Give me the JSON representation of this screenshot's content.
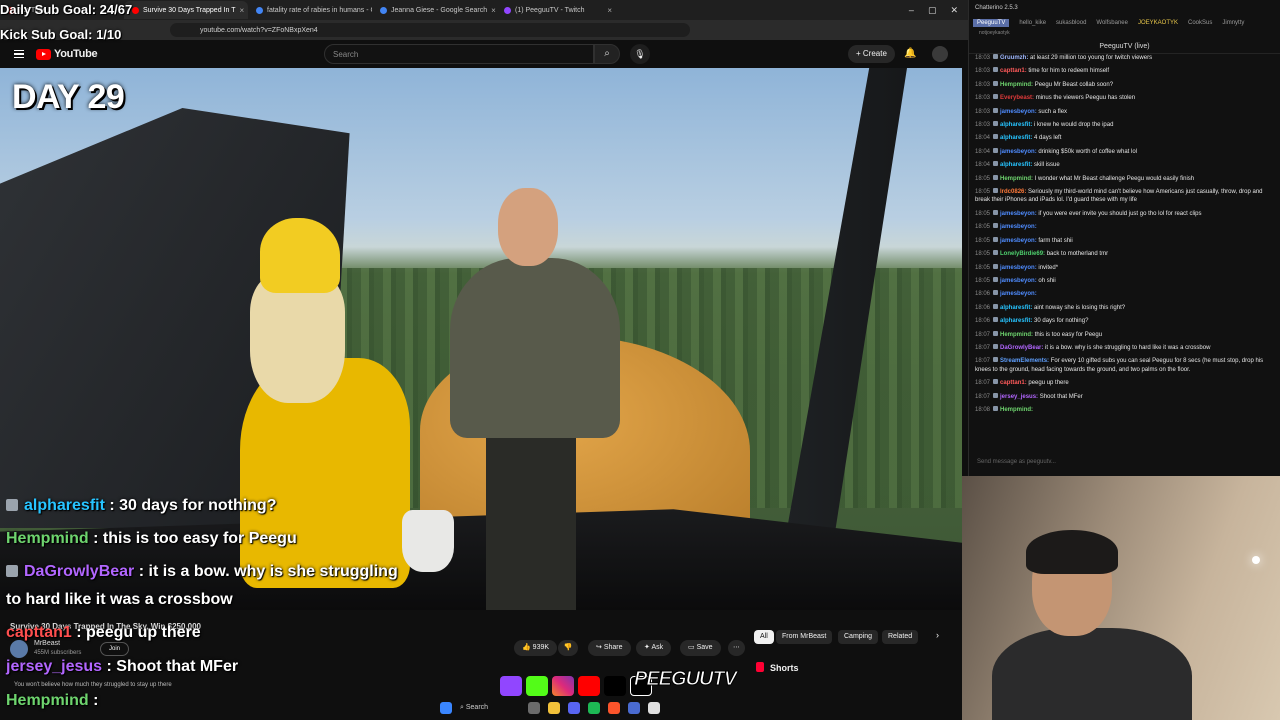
{
  "overlay_goals": {
    "daily": "Daily Sub Goal: 24/67",
    "kick": "Kick Sub Goal: 1/10"
  },
  "browser": {
    "tabs": [
      {
        "label": "YouTube",
        "color": "#ff0000"
      },
      {
        "label": "Survive 30 Days Trapped In T",
        "color": "#ff0000"
      },
      {
        "label": "fatality rate of rabies in humans - Go",
        "color": "#4285f4"
      },
      {
        "label": "Jeanna Giese - Google Search",
        "color": "#4285f4"
      },
      {
        "label": "(1) PeeguuTV - Twitch",
        "color": "#9146ff"
      }
    ],
    "url": "youtube.com/watch?v=ZFoNBxpXen4"
  },
  "youtube": {
    "logo": "YouTube",
    "search_placeholder": "Search",
    "create": "+ Create"
  },
  "video": {
    "day_label": "DAY 29",
    "title": "Survive 30 Days Trapped In The Sky, Win $250,000",
    "channel": "MrBeast",
    "subscribers": "455M subscribers",
    "join": "Join",
    "likes": "939K",
    "share": "Share",
    "ask": "Ask",
    "save": "Save",
    "description": "You won't believe how much they struggled to stay up there"
  },
  "chips": [
    "All",
    "From MrBeast",
    "Camping",
    "Related"
  ],
  "shorts_label": "Shorts",
  "brand_logo": "PEEGUUTV",
  "overlay_chat": [
    {
      "user": "alpharesfit",
      "color": "#27c4ff",
      "text": ": 30 days for nothing?",
      "badge": true
    },
    {
      "user": "Hempmind",
      "color": "#6ed46e",
      "text": ": this is too easy for Peegu",
      "badge": false
    },
    {
      "user": "DaGrowlyBear",
      "color": "#b266ff",
      "text": ": it is a bow. why is she struggling",
      "badge": true
    },
    {
      "user": "",
      "color": "#ffffff",
      "text": "to hard like it was a crossbow",
      "badge": false
    },
    {
      "user": "capttan1",
      "color": "#ff4f4f",
      "text": ": peegu up there",
      "badge": false
    },
    {
      "user": "jersey_jesus",
      "color": "#b266ff",
      "text": ": Shoot that MFer",
      "badge": false
    },
    {
      "user": "Hempmind",
      "color": "#6ed46e",
      "text": ":",
      "badge": false
    }
  ],
  "taskbar": {
    "search": "Search"
  },
  "chatterino": {
    "title": "Chatterino 2.5.3",
    "tabs": [
      "PeeguuTV",
      "hello_kike",
      "sukasblood",
      "Wolfsbanee",
      "JOEYKAOTYK",
      "CookSus",
      "Jimnytty"
    ],
    "sub_tab": "notjoeykaotyk",
    "channel": "PeeguuTV (live)",
    "input_placeholder": "Send message as peeguutv...",
    "messages": [
      {
        "time": "18:03",
        "user": "Gruumzh",
        "color": "#9fb8ff",
        "text": "at least 29 million too young for twitch viewers"
      },
      {
        "time": "18:03",
        "user": "capttan1",
        "color": "#ff5a5a",
        "text": "time for him to redeem himself"
      },
      {
        "time": "18:03",
        "user": "Hempmind",
        "color": "#6ed46e",
        "text": "Peegu Mr Beast collab soon?"
      },
      {
        "time": "18:03",
        "user": "Everybeast",
        "color": "#e03a3a",
        "text": "minus the viewers Peeguu has stolen"
      },
      {
        "time": "18:03",
        "user": "jamesbeyon",
        "color": "#4f8cff",
        "text": "such a flex"
      },
      {
        "time": "18:03",
        "user": "alpharesfit",
        "color": "#27c4ff",
        "text": "i knew he would drop the ipad"
      },
      {
        "time": "18:04",
        "user": "alpharesfit",
        "color": "#27c4ff",
        "text": "4 days left"
      },
      {
        "time": "18:04",
        "user": "jamesbeyon",
        "color": "#4f8cff",
        "text": "drinking $50k worth of coffee what lol"
      },
      {
        "time": "18:04",
        "user": "alpharesfit",
        "color": "#27c4ff",
        "text": "skill issue"
      },
      {
        "time": "18:05",
        "user": "Hempmind",
        "color": "#6ed46e",
        "text": "I wonder what Mr Beast challenge Peegu would easily finish"
      },
      {
        "time": "18:05",
        "user": "lrdc0826",
        "color": "#ff7a3a",
        "text": "Seriously my third-world mind can't believe how Americans just casually, throw, drop and break their iPhones and iPads lol. I'd guard these with my life"
      },
      {
        "time": "18:05",
        "user": "jamesbeyon",
        "color": "#4f8cff",
        "text": "if you were ever invite you should just go tho lol for react clips"
      },
      {
        "time": "18:05",
        "user": "jamesbeyon",
        "color": "#4f8cff",
        "text": ""
      },
      {
        "time": "18:05",
        "user": "jamesbeyon",
        "color": "#4f8cff",
        "text": "farm that shii"
      },
      {
        "time": "18:05",
        "user": "LonelyBirdie69",
        "color": "#4fd16e",
        "text": "back to motherland tmr"
      },
      {
        "time": "18:05",
        "user": "jamesbeyon",
        "color": "#4f8cff",
        "text": "invited*"
      },
      {
        "time": "18:05",
        "user": "jamesbeyon",
        "color": "#4f8cff",
        "text": "oh shii"
      },
      {
        "time": "18:06",
        "user": "jamesbeyon",
        "color": "#4f8cff",
        "text": ""
      },
      {
        "time": "18:06",
        "user": "alpharesfit",
        "color": "#27c4ff",
        "text": "aint noway she is losing this right?"
      },
      {
        "time": "18:06",
        "user": "alpharesfit",
        "color": "#27c4ff",
        "text": "30 days for nothing?"
      },
      {
        "time": "18:07",
        "user": "Hempmind",
        "color": "#6ed46e",
        "text": "this is too easy for Peegu"
      },
      {
        "time": "18:07",
        "user": "DaGrowlyBear",
        "color": "#b266ff",
        "text": "it is a bow. why is she struggling to hard like it was a crossbow"
      },
      {
        "time": "18:07",
        "user": "StreamElements",
        "color": "#5fa0ff",
        "text": "For every 10 gifted subs you can seal Peeguu for 8 secs (he must stop, drop his knees to the ground, head facing towards the ground, and two palms on the floor."
      },
      {
        "time": "18:07",
        "user": "capttan1",
        "color": "#ff5a5a",
        "text": "peegu up there"
      },
      {
        "time": "18:07",
        "user": "jersey_jesus",
        "color": "#b266ff",
        "text": "Shoot that MFer"
      },
      {
        "time": "18:08",
        "user": "Hempmind",
        "color": "#6ed46e",
        "text": ""
      }
    ]
  }
}
